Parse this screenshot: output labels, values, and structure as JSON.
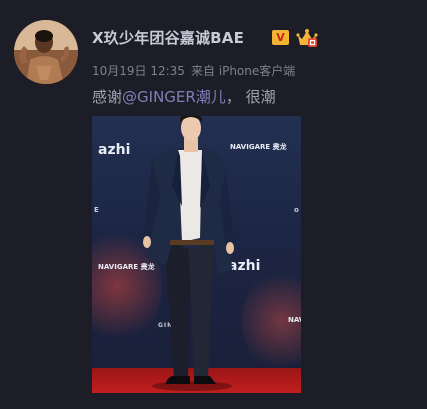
{
  "post": {
    "username": "X玖少年团谷嘉诚BAE",
    "vip_badge_text": "V",
    "timestamp": "10月19日 12:35",
    "source": "来自 iPhone客户端",
    "caption_prefix": "感谢",
    "caption_mention": "@GINGER潮儿",
    "caption_suffix": "， 很潮"
  },
  "photo": {
    "logo_azhi_top": "azhi",
    "logo_azhi_bottom": "azhi",
    "logo_brand_top": "NAVIGARE 㶳龙",
    "logo_brand_mid": "NAVIGARE 㶳龙",
    "logo_brand_right": "NAVIGARE",
    "logo_ginger": "GINGER",
    "edge_mark_left": "E",
    "edge_mark_right": "o"
  },
  "colors": {
    "background": "#1d1d27",
    "username": "#c9c9d8",
    "meta": "#7f7f90",
    "caption": "#a1a1b2",
    "mention": "#7f7fb8",
    "vip_badge": "#f1b531",
    "red_carpet": "#c01f1d"
  }
}
